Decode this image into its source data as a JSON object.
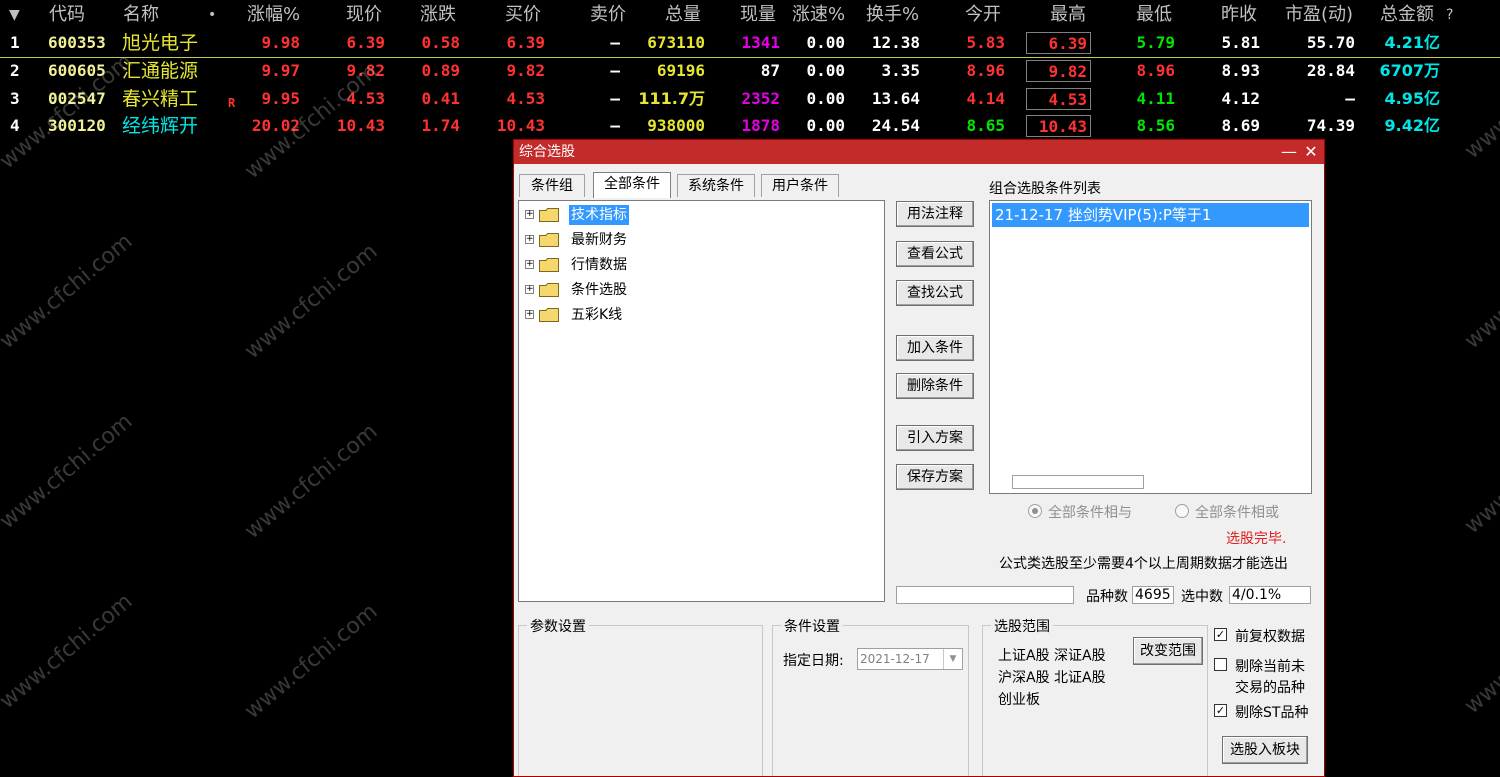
{
  "header": {
    "menu_arrow": "▼",
    "columns": [
      "代码",
      "名称",
      "•",
      "涨幅%",
      "现价",
      "涨跌",
      "买价",
      "卖价",
      "总量",
      "现量",
      "涨速%",
      "换手%",
      "今开",
      "最高",
      "最低",
      "昨收",
      "市盈(动)",
      "总金额"
    ],
    "help": "?"
  },
  "rows": [
    {
      "idx": "1",
      "code": "600353",
      "name": "旭光电子",
      "flag": "",
      "pct": "9.98",
      "price": "6.39",
      "chg": "0.58",
      "bid": "6.39",
      "ask": "—",
      "vol": "673110",
      "cur": "1341",
      "speed": "0.00",
      "turn": "12.38",
      "open": "5.83",
      "high": "6.39",
      "low": "5.79",
      "prev": "5.81",
      "pe": "55.70",
      "amount": "4.21亿"
    },
    {
      "idx": "2",
      "code": "600605",
      "name": "汇通能源",
      "flag": "",
      "pct": "9.97",
      "price": "9.82",
      "chg": "0.89",
      "bid": "9.82",
      "ask": "—",
      "vol": "69196",
      "cur": "87",
      "speed": "0.00",
      "turn": "3.35",
      "open": "8.96",
      "high": "9.82",
      "low": "8.96",
      "prev": "8.93",
      "pe": "28.84",
      "amount": "6707万"
    },
    {
      "idx": "3",
      "code": "002547",
      "name": "春兴精工",
      "flag": "R",
      "pct": "9.95",
      "price": "4.53",
      "chg": "0.41",
      "bid": "4.53",
      "ask": "—",
      "vol": "111.7万",
      "cur": "2352",
      "speed": "0.00",
      "turn": "13.64",
      "open": "4.14",
      "high": "4.53",
      "low": "4.11",
      "prev": "4.12",
      "pe": "—",
      "amount": "4.95亿"
    },
    {
      "idx": "4",
      "code": "300120",
      "name": "经纬辉开",
      "flag": "",
      "pct": "20.02",
      "price": "10.43",
      "chg": "1.74",
      "bid": "10.43",
      "ask": "—",
      "vol": "938000",
      "cur": "1878",
      "speed": "0.00",
      "turn": "24.54",
      "open": "8.65",
      "high": "10.43",
      "low": "8.56",
      "prev": "8.69",
      "pe": "74.39",
      "amount": "9.42亿"
    }
  ],
  "watermark": "www.cfchi.com",
  "dialog": {
    "title": "综合选股",
    "minimize": "—",
    "close": "✕",
    "tabs": [
      "条件组",
      "全部条件",
      "系统条件",
      "用户条件"
    ],
    "tree": [
      "技术指标",
      "最新财务",
      "行情数据",
      "条件选股",
      "五彩K线"
    ],
    "tree_expander": "+",
    "buttons": {
      "usage": "用法注释",
      "view_formula": "查看公式",
      "find_formula": "查找公式",
      "add_cond": "加入条件",
      "del_cond": "删除条件",
      "import_plan": "引入方案",
      "save_plan": "保存方案",
      "change_range": "改变范围",
      "to_block": "选股入板块"
    },
    "cond_list_title": "组合选股条件列表",
    "cond_list": [
      "21-12-17 挫剑势VIP(5):P等于1"
    ],
    "radio_and": "全部条件相与",
    "radio_or": "全部条件相或",
    "status": "选股完毕.",
    "note": "公式类选股至少需要4个以上周期数据才能选出",
    "count_label": "品种数",
    "count_value": "4695",
    "selected_label": "选中数",
    "selected_value": "4/0.1%",
    "param_group": "参数设置",
    "cond_group": "条件设置",
    "date_label": "指定日期:",
    "date_value": "2021-12-17",
    "range_group": "选股范围",
    "range_text": [
      "上证A股 深证A股",
      "沪深A股 北证A股",
      "创业板"
    ],
    "chk_fq": "前复权数据",
    "chk_untraded_1": "剔除当前未",
    "chk_untraded_2": "交易的品种",
    "chk_st": "剔除ST品种",
    "check_mark": "✓"
  },
  "colors": {
    "accent_red": "#c32a2a",
    "up": "#ff3232",
    "down": "#00e600",
    "selection": "#3399ff"
  }
}
